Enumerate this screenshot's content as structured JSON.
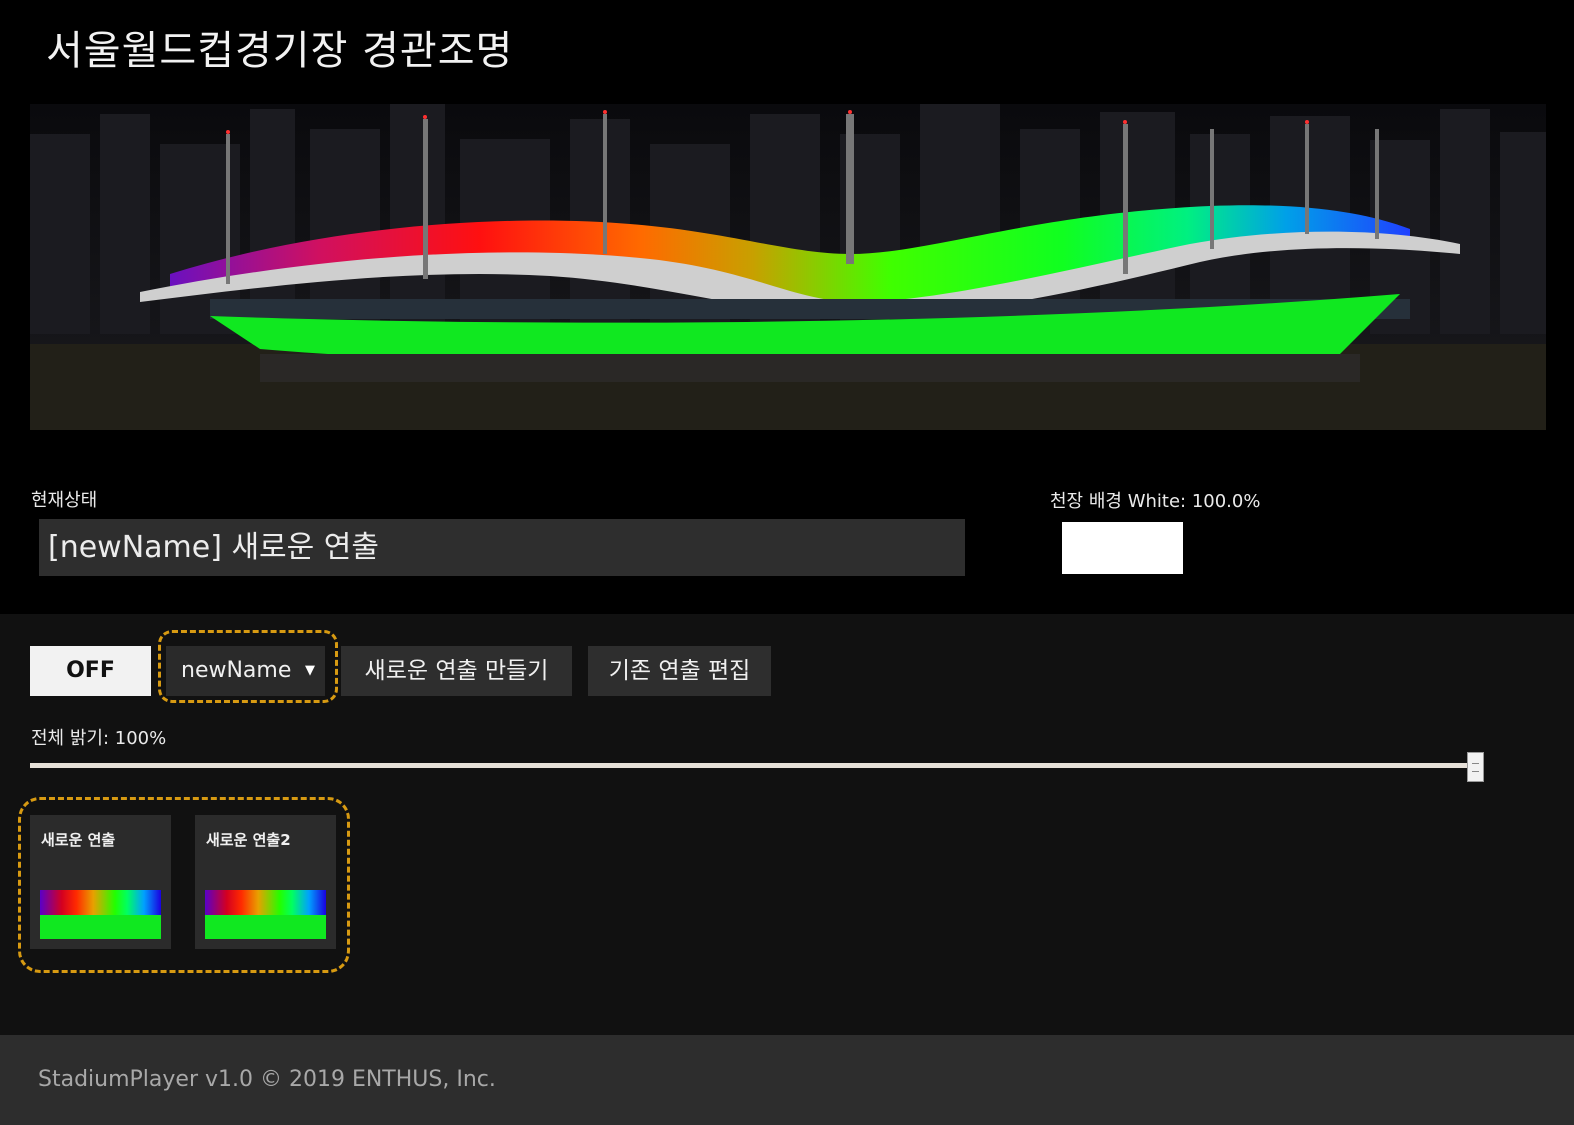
{
  "header": {
    "title": "서울월드컵경기장 경관조명"
  },
  "status": {
    "label": "현재상태",
    "value": "[newName] 새로운 연출"
  },
  "ceiling": {
    "label": "천장 배경",
    "value": "White: 100.0%",
    "color": "#ffffff"
  },
  "controls": {
    "off_label": "OFF",
    "selected_show": "newName",
    "new_show_label": "새로운 연출 만들기",
    "edit_show_label": "기존 연출 편집"
  },
  "brightness": {
    "label": "전체 밝기: 100%",
    "value": 100
  },
  "shows": [
    {
      "title": "새로운 연출"
    },
    {
      "title": "새로운 연출2"
    }
  ],
  "footer": {
    "text": "StadiumPlayer v1.0 © 2019 ENTHUS, Inc."
  },
  "colors": {
    "highlight": "#d79a12",
    "lower_ring": "#10e820",
    "panel_bg": "#111111",
    "footer_bg": "#2d2d2d"
  }
}
